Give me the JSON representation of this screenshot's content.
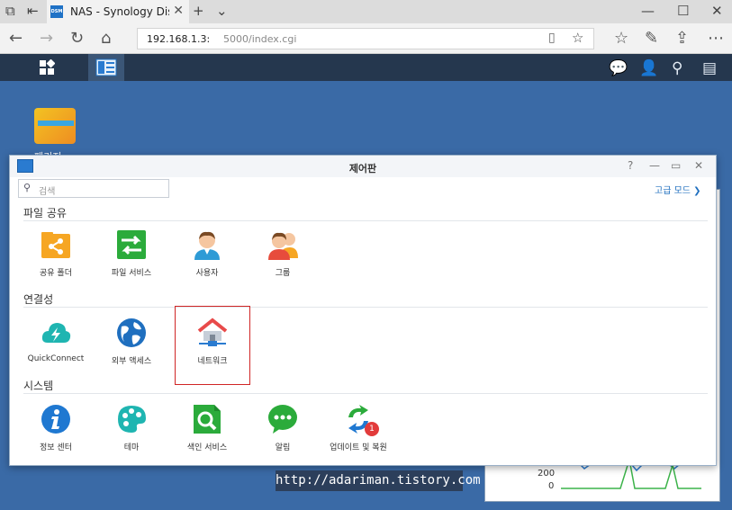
{
  "browser": {
    "tab_title": "NAS - Synology DiskSta",
    "favicon_text": "DSM",
    "url_host": "192.168.1.3:",
    "url_path": "5000/index.cgi"
  },
  "desktop": {
    "icon_label": "패키지"
  },
  "window": {
    "title": "제어판",
    "search_placeholder": "검색",
    "advanced_mode": "고급 모드 ❯",
    "sections": [
      {
        "title": "파일 공유",
        "items": [
          {
            "label": "공유 폴더",
            "icon": "shared-folder-icon"
          },
          {
            "label": "파일 서비스",
            "icon": "file-services-icon"
          },
          {
            "label": "사용자",
            "icon": "user-icon"
          },
          {
            "label": "그룹",
            "icon": "group-icon"
          }
        ]
      },
      {
        "title": "연결성",
        "items": [
          {
            "label": "QuickConnect",
            "icon": "quickconnect-icon"
          },
          {
            "label": "외부 액세스",
            "icon": "external-access-icon"
          },
          {
            "label": "네트워크",
            "icon": "network-icon"
          }
        ]
      },
      {
        "title": "시스템",
        "items": [
          {
            "label": "정보 센터",
            "icon": "info-center-icon"
          },
          {
            "label": "테마",
            "icon": "theme-icon"
          },
          {
            "label": "색인 서비스",
            "icon": "indexing-service-icon"
          },
          {
            "label": "알림",
            "icon": "notification-icon"
          },
          {
            "label": "업데이트 및 복원",
            "icon": "update-restore-icon",
            "badge": "1"
          }
        ]
      }
    ]
  },
  "widget": {
    "axis_200": "200",
    "axis_0": "0"
  },
  "watermark": "http://adariman.tistory.com",
  "colors": {
    "taskbar": "#25374e",
    "desktop": "#3a6aa6",
    "selection": "#d02525"
  }
}
